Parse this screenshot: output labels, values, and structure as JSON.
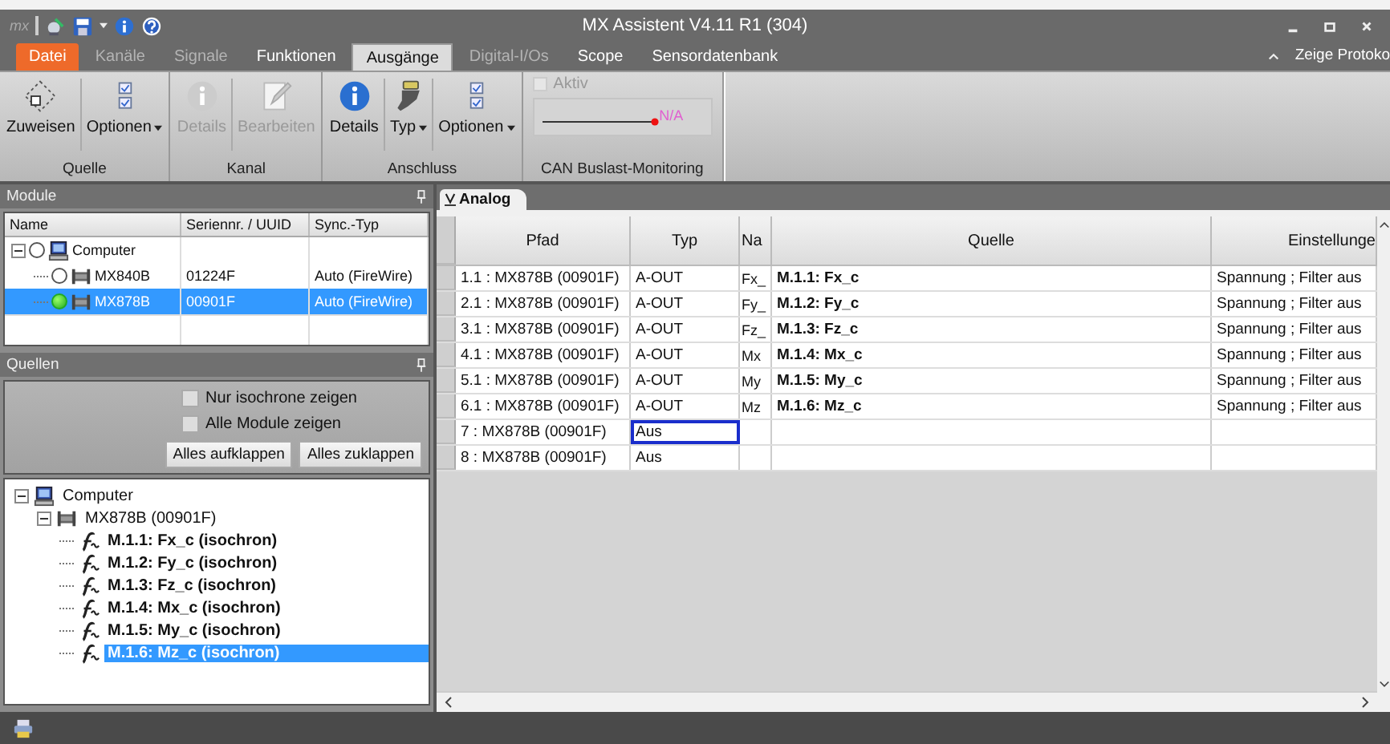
{
  "window": {
    "logo": "mx",
    "title": "MX Assistent V4.11 R1 (304)"
  },
  "tabs": [
    {
      "label": "Datei",
      "kind": "file",
      "selected": false,
      "disabled": false
    },
    {
      "label": "Kanäle",
      "kind": "tab",
      "selected": false,
      "disabled": true
    },
    {
      "label": "Signale",
      "kind": "tab",
      "selected": false,
      "disabled": true
    },
    {
      "label": "Funktionen",
      "kind": "tab",
      "selected": false,
      "disabled": false
    },
    {
      "label": "Ausgänge",
      "kind": "tab",
      "selected": true,
      "disabled": false
    },
    {
      "label": "Digital-I/Os",
      "kind": "tab",
      "selected": false,
      "disabled": true
    },
    {
      "label": "Scope",
      "kind": "tab",
      "selected": false,
      "disabled": false
    },
    {
      "label": "Sensordatenbank",
      "kind": "tab",
      "selected": false,
      "disabled": false
    }
  ],
  "log_toggle": {
    "label": "Zeige Protoko"
  },
  "ribbon": {
    "groups": [
      {
        "title": "Quelle",
        "kind": "buttons",
        "buttons": [
          {
            "label": "Zuweisen",
            "kind": "assign",
            "dropdown": false,
            "disabled": false
          },
          {
            "label": "Optionen",
            "kind": "options",
            "dropdown": true,
            "disabled": false
          }
        ]
      },
      {
        "title": "Kanal",
        "kind": "buttons",
        "buttons": [
          {
            "label": "Details",
            "kind": "info",
            "dropdown": false,
            "disabled": true
          },
          {
            "label": "Bearbeiten",
            "kind": "edit",
            "dropdown": false,
            "disabled": true
          }
        ]
      },
      {
        "title": "Anschluss",
        "kind": "buttons",
        "buttons": [
          {
            "label": "Details",
            "kind": "info",
            "dropdown": false,
            "disabled": false
          },
          {
            "label": "Typ",
            "kind": "plug",
            "dropdown": true,
            "disabled": false
          },
          {
            "label": "Optionen",
            "kind": "options",
            "dropdown": true,
            "disabled": false
          }
        ]
      },
      {
        "title": "CAN Buslast-Monitoring",
        "kind": "monitor",
        "checkbox": {
          "label": "Aktiv",
          "checked": false,
          "disabled": true
        },
        "reading": "N/A"
      }
    ]
  },
  "modules": {
    "title": "Module",
    "columns": [
      "Name",
      "Seriennr. / UUID",
      "Sync.-Typ"
    ],
    "tree": [
      {
        "name": "Computer",
        "kind": "computer",
        "online": false,
        "selected": false,
        "expanded": true,
        "children": [
          {
            "name": "MX840B",
            "kind": "device",
            "serial": "01224F",
            "sync": "Auto (FireWire)",
            "online": false,
            "selected": false
          },
          {
            "name": "MX878B",
            "kind": "device",
            "serial": "00901F",
            "sync": "Auto (FireWire)",
            "online": true,
            "selected": true
          }
        ]
      }
    ]
  },
  "sources": {
    "title": "Quellen",
    "options": [
      {
        "label": "Nur isochrone zeigen",
        "checked": false
      },
      {
        "label": "Alle Module zeigen",
        "checked": false
      }
    ],
    "buttons": [
      "Alles aufklappen",
      "Alles zuklappen"
    ],
    "tree": [
      {
        "name": "Computer",
        "kind": "computer",
        "expanded": true,
        "selected": false,
        "children": [
          {
            "name": "MX878B (00901F)",
            "kind": "device",
            "expanded": true,
            "selected": false,
            "children": [
              {
                "name": "M.1.1: Fx_c (isochron)",
                "kind": "signal",
                "selected": false
              },
              {
                "name": "M.1.2: Fy_c (isochron)",
                "kind": "signal",
                "selected": false
              },
              {
                "name": "M.1.3: Fz_c (isochron)",
                "kind": "signal",
                "selected": false
              },
              {
                "name": "M.1.4: Mx_c (isochron)",
                "kind": "signal",
                "selected": false
              },
              {
                "name": "M.1.5: My_c (isochron)",
                "kind": "signal",
                "selected": false
              },
              {
                "name": "M.1.6: Mz_c (isochron)",
                "kind": "signal",
                "selected": true
              }
            ]
          }
        ]
      }
    ]
  },
  "grid": {
    "tab": {
      "label": "Analog"
    },
    "columns": [
      "Pfad",
      "Typ",
      "Na",
      "Quelle",
      "Einstellunge"
    ],
    "rows": [
      {
        "path": "1.1 : MX878B (00901F)",
        "type": "A-OUT",
        "column_3": "Fx_",
        "source": "M.1.1: Fx_c",
        "settings": "Spannung ; Filter aus",
        "focused": false
      },
      {
        "path": "2.1 : MX878B (00901F)",
        "type": "A-OUT",
        "column_3": "Fy_",
        "source": "M.1.2: Fy_c",
        "settings": "Spannung ; Filter aus",
        "focused": false
      },
      {
        "path": "3.1 : MX878B (00901F)",
        "type": "A-OUT",
        "column_3": "Fz_",
        "source": "M.1.3: Fz_c",
        "settings": "Spannung ; Filter aus",
        "focused": false
      },
      {
        "path": "4.1 : MX878B (00901F)",
        "type": "A-OUT",
        "column_3": "Mx",
        "source": "M.1.4: Mx_c",
        "settings": "Spannung ; Filter aus",
        "focused": false
      },
      {
        "path": "5.1 : MX878B (00901F)",
        "type": "A-OUT",
        "column_3": "My",
        "source": "M.1.5: My_c",
        "settings": "Spannung ; Filter aus",
        "focused": false
      },
      {
        "path": "6.1 : MX878B (00901F)",
        "type": "A-OUT",
        "column_3": "Mz",
        "source": "M.1.6: Mz_c",
        "settings": "Spannung ; Filter aus",
        "focused": false
      },
      {
        "path": "7 : MX878B (00901F)",
        "type": "Aus",
        "focused": true
      },
      {
        "path": "8 : MX878B (00901F)",
        "type": "Aus",
        "focused": false
      }
    ]
  }
}
